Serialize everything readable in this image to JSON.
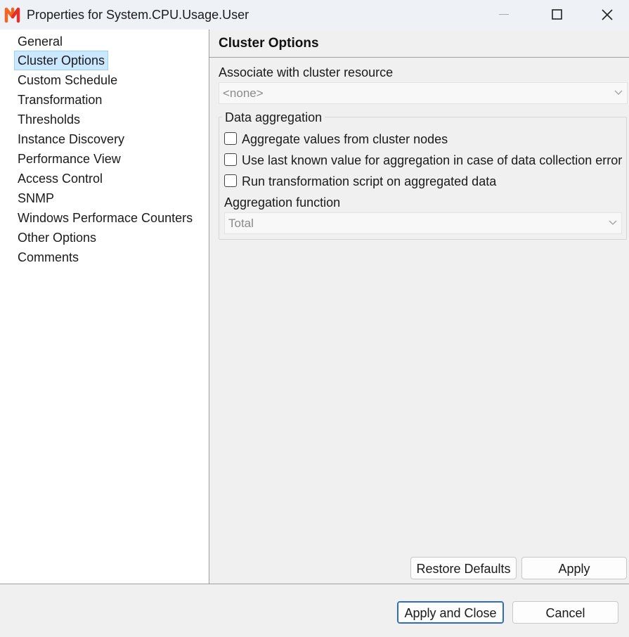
{
  "window": {
    "title": "Properties for System.CPU.Usage.User",
    "icon": "netxms-logo-icon",
    "controls": [
      "minimize-icon",
      "maximize-icon",
      "close-icon"
    ]
  },
  "sidebar": {
    "items": [
      {
        "label": "General"
      },
      {
        "label": "Cluster Options",
        "selected": true
      },
      {
        "label": "Custom Schedule"
      },
      {
        "label": "Transformation"
      },
      {
        "label": "Thresholds"
      },
      {
        "label": "Instance Discovery"
      },
      {
        "label": "Performance View"
      },
      {
        "label": "Access Control"
      },
      {
        "label": "SNMP"
      },
      {
        "label": "Windows Performace Counters"
      },
      {
        "label": "Other Options"
      },
      {
        "label": "Comments"
      }
    ]
  },
  "page": {
    "title": "Cluster Options",
    "resource_label": "Associate with cluster resource",
    "resource_value": "<none>",
    "aggregation_group_label": "Data aggregation",
    "checkboxes": [
      {
        "label": "Aggregate values from cluster nodes",
        "checked": false
      },
      {
        "label": "Use last known value for aggregation in case of data collection error",
        "checked": false
      },
      {
        "label": "Run transformation script on aggregated data",
        "checked": false
      }
    ],
    "function_label": "Aggregation function",
    "function_value": "Total",
    "restore_defaults": "Restore Defaults",
    "apply": "Apply"
  },
  "footer": {
    "apply_close": "Apply and Close",
    "cancel": "Cancel"
  },
  "colors": {
    "selection_bg": "#cce8ff",
    "selection_border": "#99d1ff",
    "default_button_border": "#2f6bbf",
    "logo_orange": "#f26522",
    "logo_red": "#e0312a"
  }
}
